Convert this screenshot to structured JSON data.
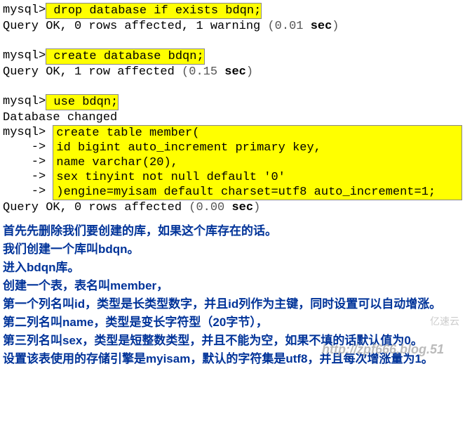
{
  "terminal": {
    "prompt": "mysql>",
    "cont": "    ->",
    "cmd1": " drop database if exists bdqn;",
    "res1a": "Query OK, 0 rows affected, 1 warning ",
    "res1b": "(",
    "res1c": "0.01 ",
    "res1d": "sec",
    "res1e": ")",
    "cmd2": " create database bdqn;",
    "res2a": "Query OK, 1 row affected ",
    "res2b": "(",
    "res2c": "0.15 ",
    "res2d": "sec",
    "res2e": ")",
    "cmd3": " use bdqn;",
    "res3": "Database changed",
    "cmd4_prompt": "mysql> ",
    "cmd4_l1": "create table member(",
    "cmd4_l2": "id bigint auto_increment primary key,",
    "cmd4_l3": "name varchar(20),",
    "cmd4_l4": "sex tinyint not null default '0'",
    "cmd4_l5": ")engine=myisam default charset=utf8 auto_increment=1;",
    "res4a": "Query OK, 0 rows affected ",
    "res4b": "(",
    "res4c": "0.00 ",
    "res4d": "sec",
    "res4e": ")"
  },
  "explain": {
    "p1": "首先先删除我们要创建的库，如果这个库存在的话。",
    "p2": "我们创建一个库叫bdqn。",
    "p3": "进入bdqn库。",
    "p4": "创建一个表，表名叫member，",
    "p5": "第一个列名叫id，类型是长类型数字，并且id列作为主键，同时设置可以自动增涨。",
    "p6": "第二列名叫name，类型是变长字符型（20字节），",
    "p7": "第三列名叫sex，类型是短整数类型，并且不能为空，如果不填的话默认值为0。",
    "p8": "设置该表使用的存储引擎是myisam，默认的字符集是utf8，并且每次增涨量为1。"
  },
  "watermark": "http://zpf666.blog.51",
  "logo": "亿速云"
}
